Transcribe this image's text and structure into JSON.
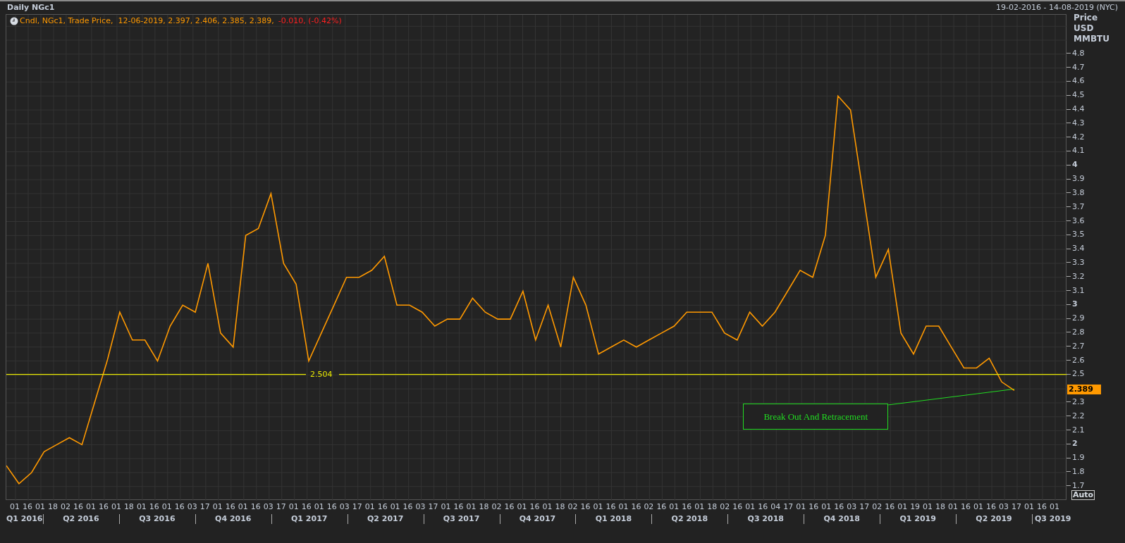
{
  "header": {
    "title": "Daily NGc1",
    "range": "19-02-2016 - 14-08-2019 (NYC)"
  },
  "legend": {
    "text": "Cndl, NGc1, Trade Price,  12-06-2019, 2.397, 2.406, 2.385, 2.389,",
    "change": "-0.010, (-0.42%)"
  },
  "y_axis": {
    "units": [
      "Price",
      "USD",
      "MMBTU"
    ],
    "last_price": "2.389",
    "auto_button": "Auto"
  },
  "support_line": {
    "label": "2.504"
  },
  "x_axis": {
    "quarters": [
      {
        "label": "Q1 2016",
        "ticks": [
          "01",
          "16"
        ]
      },
      {
        "label": "Q2 2016",
        "ticks": [
          "01",
          "18",
          "02",
          "16",
          "01",
          "16"
        ]
      },
      {
        "label": "Q3 2016",
        "ticks": [
          "01",
          "18",
          "01",
          "16",
          "01",
          "16"
        ]
      },
      {
        "label": "Q4 2016",
        "ticks": [
          "03",
          "17",
          "01",
          "16",
          "01",
          "16"
        ]
      },
      {
        "label": "Q1 2017",
        "ticks": [
          "03",
          "17",
          "01",
          "16",
          "01",
          "16"
        ]
      },
      {
        "label": "Q2 2017",
        "ticks": [
          "03",
          "17",
          "01",
          "16",
          "01",
          "16"
        ]
      },
      {
        "label": "Q3 2017",
        "ticks": [
          "03",
          "17",
          "01",
          "16",
          "01",
          "18"
        ]
      },
      {
        "label": "Q4 2017",
        "ticks": [
          "02",
          "16",
          "01",
          "16",
          "01",
          "18"
        ]
      },
      {
        "label": "Q1 2018",
        "ticks": [
          "02",
          "16",
          "01",
          "16",
          "01",
          "16"
        ]
      },
      {
        "label": "Q2 2018",
        "ticks": [
          "02",
          "16",
          "01",
          "16",
          "01",
          "18"
        ]
      },
      {
        "label": "Q3 2018",
        "ticks": [
          "02",
          "16",
          "01",
          "16",
          "04",
          "17"
        ]
      },
      {
        "label": "Q4 2018",
        "ticks": [
          "01",
          "16",
          "01",
          "16",
          "03",
          "17"
        ]
      },
      {
        "label": "Q1 2019",
        "ticks": [
          "02",
          "16",
          "01",
          "19",
          "01",
          "18"
        ]
      },
      {
        "label": "Q2 2019",
        "ticks": [
          "01",
          "16",
          "01",
          "16",
          "03",
          "17"
        ]
      },
      {
        "label": "Q3 2019",
        "ticks": [
          "01",
          "16",
          "01"
        ]
      }
    ]
  },
  "chart_data": {
    "type": "line",
    "grid": true,
    "ylim": [
      1.598,
      5.082
    ],
    "annotations": [
      {
        "text": "Break Out And Retracement"
      }
    ],
    "yticks": [
      {
        "value": 1.7,
        "label": "1.7"
      },
      {
        "value": 1.8,
        "label": "1.8"
      },
      {
        "value": 1.9,
        "label": "1.9"
      },
      {
        "value": 2,
        "label": "2"
      },
      {
        "value": 2.1,
        "label": "2.1"
      },
      {
        "value": 2.2,
        "label": "2.2"
      },
      {
        "value": 2.3,
        "label": "2.3"
      },
      {
        "value": 2.5,
        "label": "2.5"
      },
      {
        "value": 2.6,
        "label": "2.6"
      },
      {
        "value": 2.7,
        "label": "2.7"
      },
      {
        "value": 2.8,
        "label": "2.8"
      },
      {
        "value": 2.9,
        "label": "2.9"
      },
      {
        "value": 3,
        "label": "3"
      },
      {
        "value": 3.1,
        "label": "3.1"
      },
      {
        "value": 3.2,
        "label": "3.2"
      },
      {
        "value": 3.3,
        "label": "3.3"
      },
      {
        "value": 3.4,
        "label": "3.4"
      },
      {
        "value": 3.5,
        "label": "3.5"
      },
      {
        "value": 3.6,
        "label": "3.6"
      },
      {
        "value": 3.7,
        "label": "3.7"
      },
      {
        "value": 3.8,
        "label": "3.8"
      },
      {
        "value": 3.9,
        "label": "3.9"
      },
      {
        "value": 4,
        "label": "4"
      },
      {
        "value": 4.1,
        "label": "4.1"
      },
      {
        "value": 4.2,
        "label": "4.2"
      },
      {
        "value": 4.3,
        "label": "4.3"
      },
      {
        "value": 4.4,
        "label": "4.4"
      },
      {
        "value": 4.5,
        "label": "4.5"
      },
      {
        "value": 4.6,
        "label": "4.6"
      },
      {
        "value": 4.7,
        "label": "4.7"
      },
      {
        "value": 4.8,
        "label": "4.8"
      }
    ],
    "categories": [
      null,
      null,
      null,
      null,
      null,
      null,
      null,
      null,
      null,
      null,
      null,
      null,
      null,
      null,
      null,
      null,
      null,
      null,
      null,
      null,
      null,
      null,
      null,
      null,
      null,
      null,
      null,
      null,
      null,
      null,
      null,
      null,
      null,
      null,
      null,
      null,
      null,
      null,
      null,
      null,
      null,
      null,
      null,
      null,
      null,
      null,
      null,
      null,
      null,
      null,
      null,
      null,
      null,
      null,
      null,
      null,
      null,
      null,
      null,
      null,
      null,
      null,
      null,
      null,
      null,
      null,
      null,
      null,
      null,
      null,
      null,
      null,
      null,
      null,
      null,
      null,
      null,
      null,
      null,
      null,
      null
    ],
    "series": [
      {
        "color": "#22dd22",
        "values": [
          null,
          null,
          null,
          null,
          null,
          null,
          null,
          null,
          null,
          null,
          null,
          null,
          null,
          null,
          null,
          null,
          null,
          null,
          null,
          null,
          null,
          null,
          null,
          null,
          null,
          null,
          null,
          null,
          null,
          null,
          null,
          null,
          null,
          null,
          null,
          null,
          null,
          null,
          null,
          null,
          null,
          null,
          null,
          null,
          null,
          null,
          null,
          null,
          null,
          null,
          null,
          null,
          null,
          null,
          null,
          null,
          null,
          null,
          null,
          null,
          null,
          null,
          null,
          null,
          null,
          null,
          null,
          null,
          null,
          null,
          2.285,
          null,
          null,
          null,
          null,
          null,
          null,
          null,
          null,
          null,
          2.399
        ]
      },
      {
        "color": "#ff9900",
        "values": [
          1.85,
          1.72,
          1.8,
          1.95,
          2.0,
          2.05,
          2.0,
          2.3,
          2.6,
          2.95,
          2.75,
          2.75,
          2.6,
          2.85,
          3.0,
          2.95,
          3.3,
          2.8,
          2.7,
          3.5,
          3.55,
          3.8,
          3.3,
          3.15,
          2.6,
          2.8,
          3.0,
          3.2,
          3.2,
          3.25,
          3.35,
          3.0,
          3.0,
          2.95,
          2.85,
          2.9,
          2.9,
          3.05,
          2.95,
          2.9,
          2.9,
          3.1,
          2.75,
          3.0,
          2.7,
          3.2,
          3.0,
          2.65,
          2.7,
          2.75,
          2.7,
          2.75,
          2.8,
          2.85,
          2.95,
          2.95,
          2.95,
          2.8,
          2.75,
          2.95,
          2.85,
          2.95,
          3.1,
          3.25,
          3.2,
          3.5,
          4.5,
          4.4,
          3.8,
          3.2,
          3.4,
          2.8,
          2.65,
          2.85,
          2.85,
          2.7,
          2.55,
          2.55,
          2.62,
          2.45,
          2.389
        ]
      }
    ]
  }
}
